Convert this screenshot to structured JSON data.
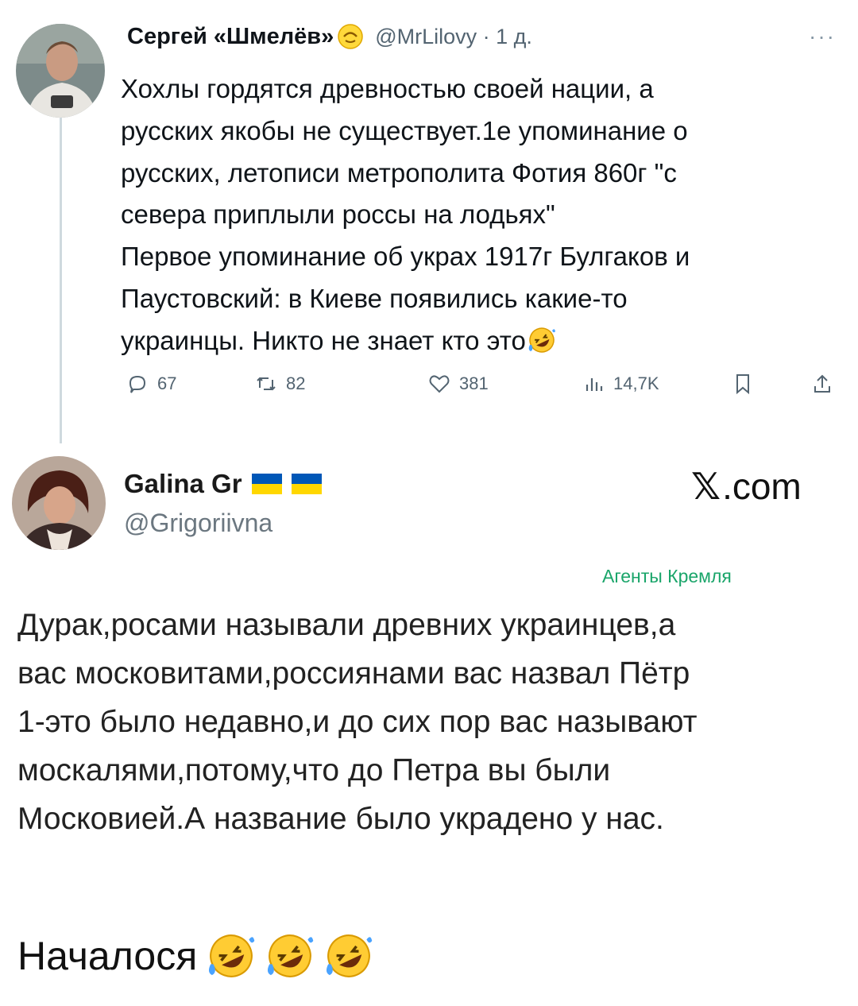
{
  "tweet1": {
    "author_name": "Сергей «Шмелёв»",
    "handle_time": "@MrLilovy · 1 д.",
    "more_label": "···",
    "text_lines": [
      "Хохлы гордятся древностью своей нации, а",
      "русских якобы не существует.1е упоминание о",
      "русских, летописи метрополита Фотия 860г \"с",
      "севера приплыли россы на лодьях\"",
      "Первое упоминание об украх 1917г Булгаков и",
      "Паустовский: в Киеве появились какие-то",
      "украинцы. Никто не знает кто это"
    ],
    "actions": {
      "replies": "67",
      "retweets": "82",
      "likes": "381",
      "views": "14,7K"
    }
  },
  "tweet2": {
    "author_name": "Galina Gr",
    "handle": "@Grigoriivna",
    "text_lines": [
      "Дурак,росами называли древних украинцев,а",
      "вас московитами,россиянами вас назвал Пётр",
      "1-это было недавно,и до сих пор вас называют",
      "москалями,потому,что до Петра вы были",
      "Московией.А название было украдено у нас."
    ]
  },
  "brand": {
    "x_glyph": "𝕏",
    "suffix": ".com"
  },
  "watermark": "Агенты Кремля",
  "caption": "Началося",
  "icons": [
    "face-emoji",
    "rofl-emoji",
    "reply-icon",
    "retweet-icon",
    "like-icon",
    "views-icon",
    "bookmark-icon",
    "share-icon",
    "ukraine-flag-icon"
  ],
  "colors": {
    "text": "#0f1419",
    "secondary": "#536471",
    "watermark": "#1aa56a",
    "flag_blue": "#0057b7",
    "flag_yellow": "#ffd700"
  }
}
